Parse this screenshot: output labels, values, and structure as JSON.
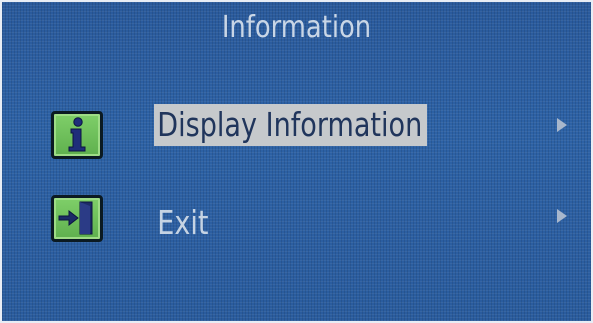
{
  "menu": {
    "title": "Information",
    "items": [
      {
        "label": "Display Information",
        "icon": "info-icon",
        "selected": true
      },
      {
        "label": "Exit",
        "icon": "exit-door-icon",
        "selected": false
      }
    ]
  },
  "colors": {
    "background": "#2d62a6",
    "title_text": "#c9d6e6",
    "item_text": "#c5d3e3",
    "highlight_bg": "#c6c9cc",
    "highlight_text": "#20355c",
    "icon_green": "#6cc05a",
    "arrow": "#a8b7cc"
  }
}
